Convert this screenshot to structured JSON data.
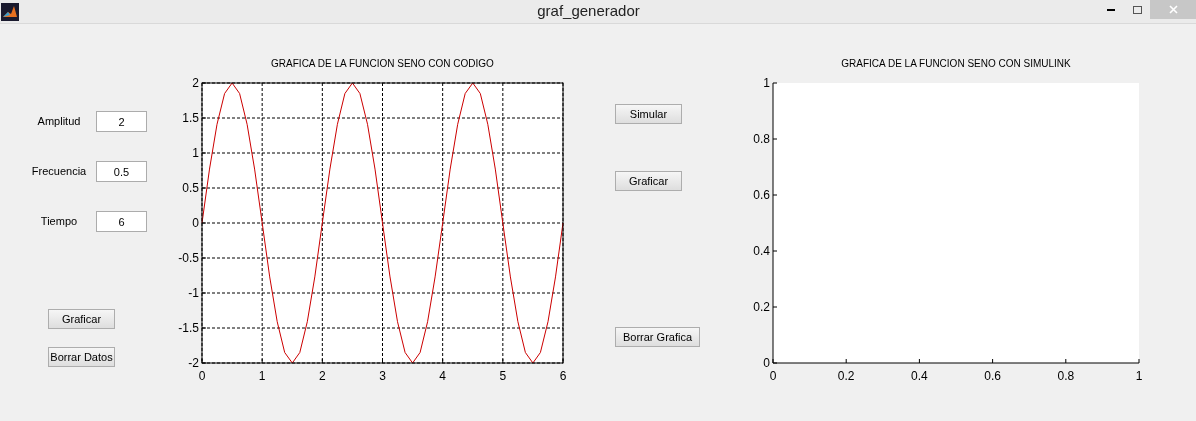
{
  "window": {
    "title": "graf_generador"
  },
  "inputs": [
    {
      "label": "Amplitud",
      "value": "2"
    },
    {
      "label": "Frecuencia",
      "value": "0.5"
    },
    {
      "label": "Tiempo",
      "value": "6"
    }
  ],
  "left_buttons": [
    "Graficar",
    "Borrar Datos"
  ],
  "code_plot": {
    "box": true,
    "chart_data": {
      "type": "line",
      "title": "GRAFICA DE LA FUNCION SENO CON CODIGO",
      "grid": true,
      "x": [
        0,
        0.125,
        0.25,
        0.375,
        0.5,
        0.625,
        0.75,
        0.875,
        1,
        1.125,
        1.25,
        1.375,
        1.5,
        1.625,
        1.75,
        1.875,
        2,
        2.125,
        2.25,
        2.375,
        2.5,
        2.625,
        2.75,
        2.875,
        3,
        3.125,
        3.25,
        3.375,
        3.5,
        3.625,
        3.75,
        3.875,
        4,
        4.125,
        4.25,
        4.375,
        4.5,
        4.625,
        4.75,
        4.875,
        5,
        5.125,
        5.25,
        5.375,
        5.5,
        5.625,
        5.75,
        5.875,
        6
      ],
      "series": [
        {
          "color": "#cc0000",
          "values": [
            0,
            0.77,
            1.41,
            1.85,
            2,
            1.85,
            1.41,
            0.77,
            0,
            -0.77,
            -1.41,
            -1.85,
            -2,
            -1.85,
            -1.41,
            -0.77,
            0,
            0.77,
            1.41,
            1.85,
            2,
            1.85,
            1.41,
            0.77,
            0,
            -0.77,
            -1.41,
            -1.85,
            -2,
            -1.85,
            -1.41,
            -0.77,
            0,
            0.77,
            1.41,
            1.85,
            2,
            1.85,
            1.41,
            0.77,
            0,
            -0.77,
            -1.41,
            -1.85,
            -2,
            -1.85,
            -1.41,
            -0.77,
            0
          ]
        }
      ],
      "xlim": [
        0,
        6
      ],
      "ylim": [
        -2,
        2
      ],
      "xticks": [
        0,
        1,
        2,
        3,
        4,
        5,
        6
      ],
      "yticks": [
        -2,
        -1.5,
        -1,
        -0.5,
        0,
        0.5,
        1,
        1.5,
        2
      ]
    }
  },
  "right_buttons": [
    "Simular",
    "Graficar",
    "Borrar Grafica"
  ],
  "simulink_plot": {
    "box": false,
    "chart_data": {
      "type": "line",
      "title": "GRAFICA DE LA FUNCION SENO CON SIMULINK",
      "grid": false,
      "xlim": [
        0,
        1
      ],
      "ylim": [
        0,
        1
      ],
      "xticks": [
        0,
        0.2,
        0.4,
        0.6,
        0.8,
        1
      ],
      "yticks": [
        0,
        0.2,
        0.4,
        0.6,
        0.8,
        1
      ]
    }
  }
}
